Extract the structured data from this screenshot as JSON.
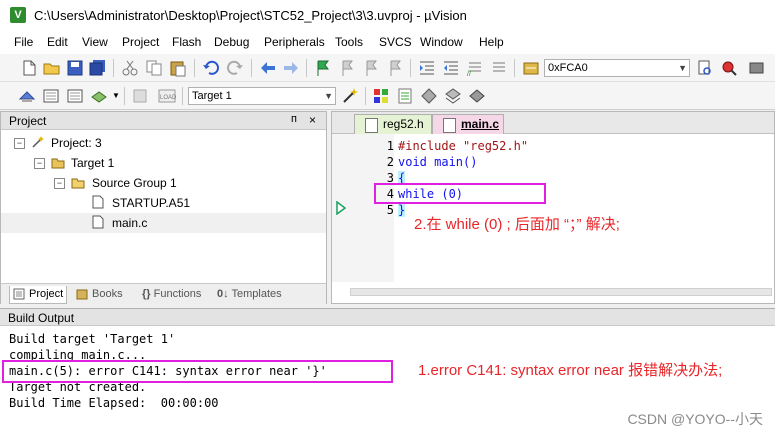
{
  "window": {
    "title": "C:\\Users\\Administrator\\Desktop\\Project\\STC52_Project\\3\\3.uvproj - µVision"
  },
  "menu": [
    "File",
    "Edit",
    "View",
    "Project",
    "Flash",
    "Debug",
    "Peripherals",
    "Tools",
    "SVCS",
    "Window",
    "Help"
  ],
  "toolbar": {
    "address_value": "0xFCA0",
    "target_value": "Target 1"
  },
  "project_pane": {
    "title": "Project",
    "pin_glyph": "ᴨ",
    "close_glyph": "×",
    "tree": {
      "project": "Project: 3",
      "target": "Target 1",
      "group": "Source Group 1",
      "file1": "STARTUP.A51",
      "file2": "main.c"
    },
    "tabs": [
      "Project",
      "Books",
      "Functions",
      "Templates"
    ],
    "tab_prefix_functions": "{}",
    "tab_prefix_templates": "0↓"
  },
  "editor": {
    "tabs": [
      "reg52.h",
      "main.c"
    ],
    "lines": [
      {
        "num": "1",
        "text": "#include \"reg52.h\""
      },
      {
        "num": "2",
        "text": "void main()"
      },
      {
        "num": "3",
        "text": "{"
      },
      {
        "num": "4",
        "text": "while (0)"
      },
      {
        "num": "5",
        "text": "}"
      }
    ],
    "annotation": "2.在 while (0) ; 后面加 “；” 解决;"
  },
  "build_output": {
    "title": "Build Output",
    "lines": [
      "Build target 'Target 1'",
      "compiling main.c...",
      "main.c(5): error C141: syntax error near '}'",
      "Target not created.",
      "Build Time Elapsed:  00:00:00"
    ],
    "annotation": "1.error C141: syntax error near 报错解决办法;"
  },
  "watermark": "CSDN @YOYO--小天",
  "colors": {
    "accent_annotation": "#e8262a",
    "highlight_box": "#e020e0",
    "keyword": "#1111ee",
    "string": "#a31515"
  }
}
